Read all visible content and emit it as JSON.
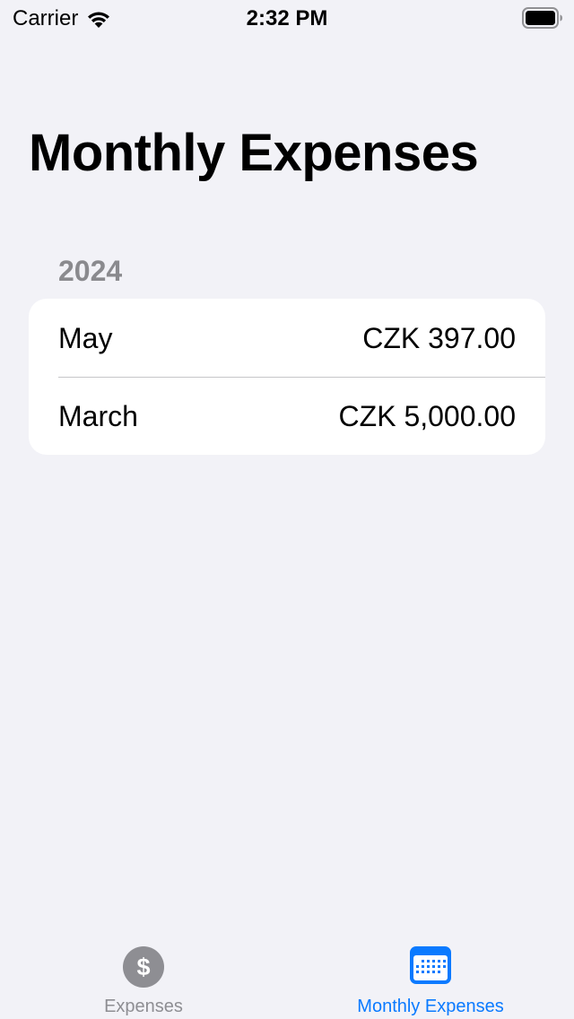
{
  "status_bar": {
    "carrier": "Carrier",
    "time": "2:32 PM",
    "wifi_icon": "wifi-icon",
    "battery_icon": "battery-full-icon"
  },
  "page": {
    "title": "Monthly Expenses"
  },
  "sections": [
    {
      "header": "2024",
      "rows": [
        {
          "month": "May",
          "amount": "CZK 397.00"
        },
        {
          "month": "March",
          "amount": "CZK 5,000.00"
        }
      ]
    }
  ],
  "tab_bar": {
    "tabs": [
      {
        "label": "Expenses",
        "icon": "dollar-circle-icon",
        "selected": false
      },
      {
        "label": "Monthly Expenses",
        "icon": "calendar-icon",
        "selected": true
      }
    ]
  },
  "colors": {
    "background": "#f2f2f7",
    "card": "#ffffff",
    "accent": "#0a7aff",
    "inactive": "#8e8e93",
    "separator": "#c6c6c8",
    "section_header": "#8a8a8e"
  }
}
